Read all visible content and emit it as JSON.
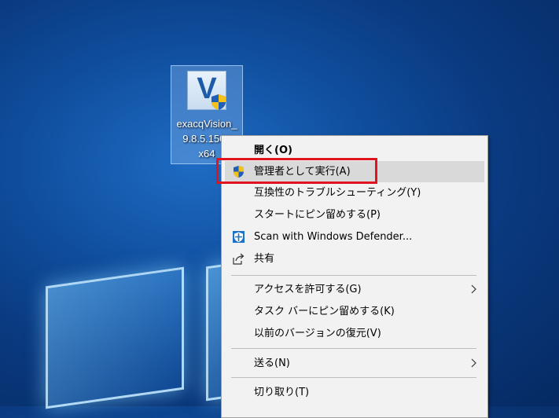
{
  "desktop": {
    "icon": {
      "label_line1": "exacqVision_",
      "label_line2": "9.8.5.1506",
      "label_line3": "x64",
      "icon_name": "installer-shield-icon"
    }
  },
  "context_menu": {
    "items": [
      {
        "label": "開く(O)",
        "bold": true
      },
      {
        "label": "管理者として実行(A)",
        "icon": "uac-shield-icon",
        "highlighted": true
      },
      {
        "label": "互換性のトラブルシューティング(Y)"
      },
      {
        "label": "スタートにピン留めする(P)"
      },
      {
        "label": "Scan with Windows Defender...",
        "icon": "defender-icon"
      },
      {
        "label": "共有",
        "icon": "share-icon"
      },
      {
        "label": "アクセスを許可する(G)",
        "submenu": true
      },
      {
        "label": "タスク バーにピン留めする(K)"
      },
      {
        "label": "以前のバージョンの復元(V)"
      },
      {
        "label": "送る(N)",
        "submenu": true
      },
      {
        "label": "切り取り(T)"
      }
    ]
  },
  "colors": {
    "highlight_border": "#e0141e",
    "menu_background": "#f2f2f2",
    "desktop_blue": "#0f4d9c"
  }
}
